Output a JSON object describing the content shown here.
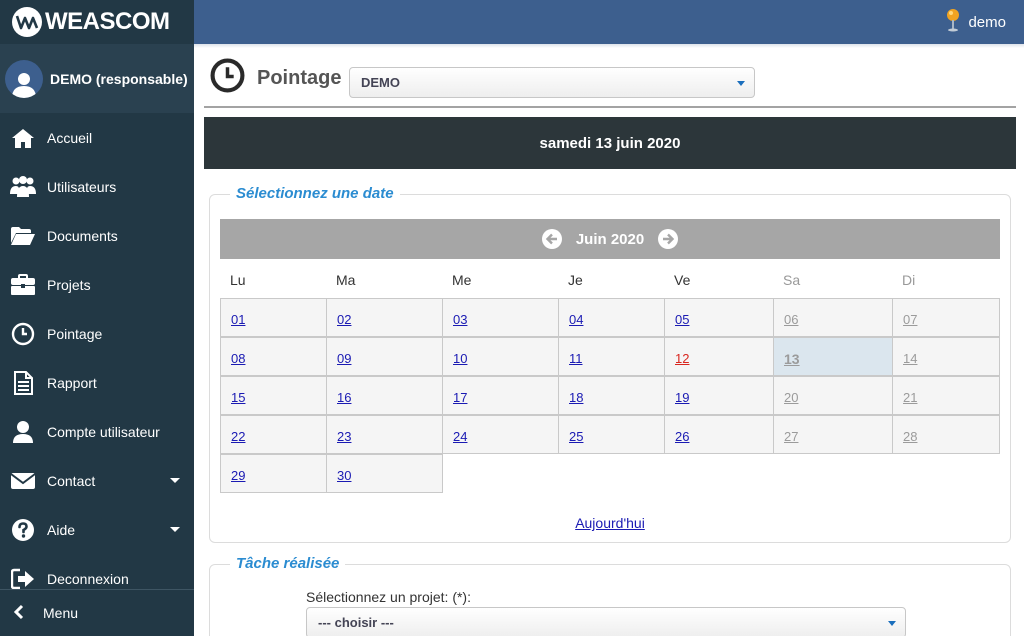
{
  "brand": {
    "name": "WEASCOM"
  },
  "topbar": {
    "user_name": "demo"
  },
  "sidebar": {
    "profile_name": "DEMO (responsable)",
    "items": [
      {
        "label": "Accueil",
        "icon": "home-icon"
      },
      {
        "label": "Utilisateurs",
        "icon": "users-icon"
      },
      {
        "label": "Documents",
        "icon": "folder-open-icon"
      },
      {
        "label": "Projets",
        "icon": "briefcase-icon"
      },
      {
        "label": "Pointage",
        "icon": "clock-icon"
      },
      {
        "label": "Rapport",
        "icon": "report-icon"
      },
      {
        "label": "Compte utilisateur",
        "icon": "user-icon"
      },
      {
        "label": "Contact",
        "icon": "envelope-icon"
      },
      {
        "label": "Aide",
        "icon": "question-icon"
      },
      {
        "label": "Deconnexion",
        "icon": "logout-icon"
      }
    ],
    "menu_toggle": "Menu"
  },
  "page": {
    "title": "Pointage",
    "selected_user": "DEMO",
    "date_banner": "samedi 13 juin 2020"
  },
  "calendar": {
    "legend": "Sélectionnez une date",
    "month_label": "Juin 2020",
    "weekdays": [
      "Lu",
      "Ma",
      "Me",
      "Je",
      "Ve",
      "Sa",
      "Di"
    ],
    "weeks": [
      [
        "01",
        "02",
        "03",
        "04",
        "05",
        "06",
        "07"
      ],
      [
        "08",
        "09",
        "10",
        "11",
        "12",
        "13",
        "14"
      ],
      [
        "15",
        "16",
        "17",
        "18",
        "19",
        "20",
        "21"
      ],
      [
        "22",
        "23",
        "24",
        "25",
        "26",
        "27",
        "28"
      ],
      [
        "29",
        "30"
      ]
    ],
    "today_link": "Aujourd'hui",
    "colors": {
      "header": "#a6a6a6",
      "day_link": "#1a1ab3",
      "weekend": "#9b9b9b",
      "holiday": "#d9261f",
      "selected_bg": "#dbe6ee"
    }
  },
  "task": {
    "legend": "Tâche réalisée",
    "project_label": "Sélectionnez un projet: (*):",
    "project_select": "--- choisir ---"
  },
  "colors": {
    "topbar": "#3d5f8e",
    "sidebar": "#223845",
    "accent": "#2b8cd1",
    "banner": "#2c363a"
  }
}
